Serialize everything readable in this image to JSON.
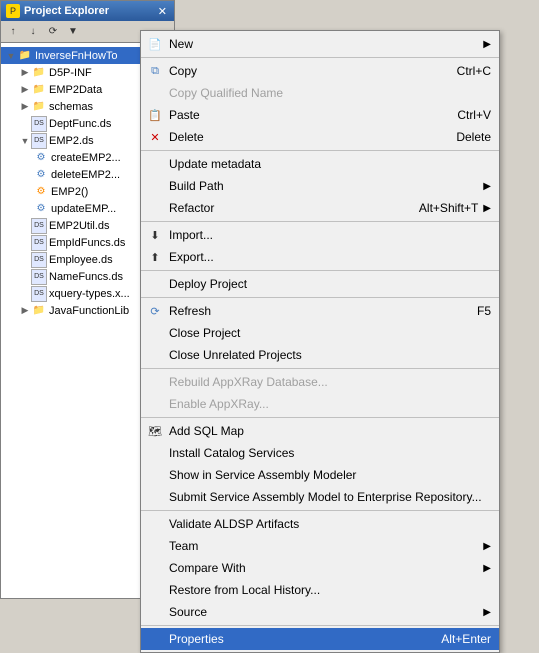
{
  "window": {
    "title": "Project Explorer",
    "close_label": "✕"
  },
  "toolbar": {
    "buttons": [
      "↑",
      "↓",
      "⟳",
      "▼"
    ]
  },
  "tree": {
    "root": "InverseFnHowTo",
    "items": [
      {
        "id": "root",
        "label": "InverseFnHowTo",
        "depth": 0,
        "expanded": true,
        "icon": "folder"
      },
      {
        "id": "d5p-inf",
        "label": "D5P-INF",
        "depth": 1,
        "expanded": false,
        "icon": "folder"
      },
      {
        "id": "emp2data",
        "label": "EMP2Data",
        "depth": 1,
        "expanded": false,
        "icon": "folder"
      },
      {
        "id": "schemas",
        "label": "schemas",
        "depth": 1,
        "expanded": false,
        "icon": "folder"
      },
      {
        "id": "deptfunc",
        "label": "DeptFunc.ds",
        "depth": 1,
        "expanded": false,
        "icon": "ds"
      },
      {
        "id": "emp2ds",
        "label": "EMP2.ds",
        "depth": 1,
        "expanded": true,
        "icon": "ds"
      },
      {
        "id": "createEMP2",
        "label": "createEMP2...",
        "depth": 2,
        "icon": "func"
      },
      {
        "id": "deleteEMP2",
        "label": "deleteEMP2...",
        "depth": 2,
        "icon": "func"
      },
      {
        "id": "EMP2fn",
        "label": "EMP2()",
        "depth": 2,
        "icon": "func"
      },
      {
        "id": "updateEMP",
        "label": "updateEMP...",
        "depth": 2,
        "icon": "func"
      },
      {
        "id": "emp2util",
        "label": "EMP2Util.ds",
        "depth": 1,
        "expanded": false,
        "icon": "ds"
      },
      {
        "id": "empidFuncs",
        "label": "EmpIdFuncs.ds",
        "depth": 1,
        "expanded": false,
        "icon": "ds"
      },
      {
        "id": "employee",
        "label": "Employee.ds",
        "depth": 1,
        "expanded": false,
        "icon": "ds"
      },
      {
        "id": "nameFuncs",
        "label": "NameFuncs.ds",
        "depth": 1,
        "expanded": false,
        "icon": "ds"
      },
      {
        "id": "xquery",
        "label": "xquery-types.x...",
        "depth": 1,
        "expanded": false,
        "icon": "ds"
      },
      {
        "id": "javaFnLib",
        "label": "JavaFunctionLib",
        "depth": 1,
        "expanded": false,
        "icon": "folder"
      }
    ]
  },
  "context_menu": {
    "items": [
      {
        "id": "new",
        "label": "New",
        "has_arrow": true,
        "icon": "📄",
        "shortcut": ""
      },
      {
        "id": "sep1",
        "type": "separator"
      },
      {
        "id": "copy",
        "label": "Copy",
        "shortcut": "Ctrl+C",
        "icon": "📋"
      },
      {
        "id": "copy-qualified",
        "label": "Copy Qualified Name",
        "disabled": true,
        "icon": ""
      },
      {
        "id": "paste",
        "label": "Paste",
        "shortcut": "Ctrl+V",
        "icon": "📋"
      },
      {
        "id": "delete",
        "label": "Delete",
        "shortcut": "Delete",
        "icon": "✕",
        "is_delete": true
      },
      {
        "id": "sep2",
        "type": "separator"
      },
      {
        "id": "update-meta",
        "label": "Update metadata",
        "icon": ""
      },
      {
        "id": "build-path",
        "label": "Build Path",
        "has_arrow": true,
        "icon": ""
      },
      {
        "id": "refactor",
        "label": "Refactor",
        "shortcut": "Alt+Shift+T",
        "has_arrow": true,
        "icon": ""
      },
      {
        "id": "sep3",
        "type": "separator"
      },
      {
        "id": "import",
        "label": "Import...",
        "icon": "⬇"
      },
      {
        "id": "export",
        "label": "Export...",
        "icon": "⬆"
      },
      {
        "id": "sep4",
        "type": "separator"
      },
      {
        "id": "deploy",
        "label": "Deploy Project",
        "icon": ""
      },
      {
        "id": "sep5",
        "type": "separator"
      },
      {
        "id": "refresh",
        "label": "Refresh",
        "shortcut": "F5",
        "icon": "⟳"
      },
      {
        "id": "close-project",
        "label": "Close Project",
        "icon": ""
      },
      {
        "id": "close-unrelated",
        "label": "Close Unrelated Projects",
        "icon": ""
      },
      {
        "id": "sep6",
        "type": "separator"
      },
      {
        "id": "rebuild-appxray",
        "label": "Rebuild AppXRay Database...",
        "disabled": true,
        "icon": ""
      },
      {
        "id": "enable-appxray",
        "label": "Enable AppXRay...",
        "disabled": true,
        "icon": ""
      },
      {
        "id": "sep7",
        "type": "separator"
      },
      {
        "id": "add-sql",
        "label": "Add SQL Map",
        "icon": "🗺"
      },
      {
        "id": "install-catalog",
        "label": "Install Catalog Services",
        "icon": ""
      },
      {
        "id": "show-modeler",
        "label": "Show in Service Assembly Modeler",
        "icon": ""
      },
      {
        "id": "submit-service",
        "label": "Submit Service Assembly Model to Enterprise Repository...",
        "icon": ""
      },
      {
        "id": "sep8",
        "type": "separator"
      },
      {
        "id": "validate",
        "label": "Validate ALDSP Artifacts",
        "icon": ""
      },
      {
        "id": "team",
        "label": "Team",
        "has_arrow": true,
        "icon": ""
      },
      {
        "id": "compare-with",
        "label": "Compare With",
        "has_arrow": true,
        "icon": ""
      },
      {
        "id": "restore",
        "label": "Restore from Local History...",
        "icon": ""
      },
      {
        "id": "source",
        "label": "Source",
        "has_arrow": true,
        "icon": ""
      },
      {
        "id": "sep9",
        "type": "separator"
      },
      {
        "id": "properties",
        "label": "Properties",
        "shortcut": "Alt+Enter",
        "highlighted": true,
        "icon": ""
      }
    ]
  }
}
